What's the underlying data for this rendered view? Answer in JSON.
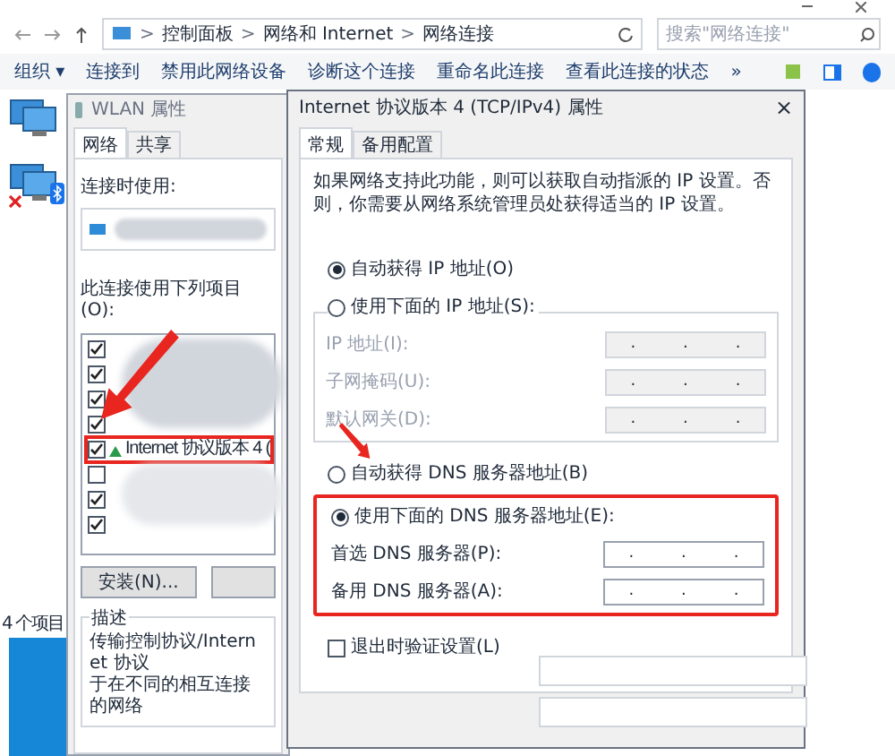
{
  "explorer": {
    "breadcrumbs": [
      "控制面板",
      "网络和 Internet",
      "网络连接"
    ],
    "separator": ">",
    "search": {
      "placeholder": "搜索\"网络连接\""
    },
    "toolbar": [
      "组织 ▾",
      "连接到",
      "禁用此网络设备",
      "诊断这个连接",
      "重命名此连接",
      "查看此连接的状态",
      "»"
    ],
    "connections": [
      {
        "kind": "ethernet",
        "disconnected": false
      },
      {
        "kind": "bluetooth",
        "disconnected": true
      }
    ],
    "status": "4 个项目"
  },
  "wlan_dialog": {
    "title": "WLAN 属性",
    "tabs": [
      {
        "label": "网络",
        "selected": true
      },
      {
        "label": "共享",
        "selected": false
      }
    ],
    "connect_using_label": "连接时使用:",
    "items_label": "此连接使用下列项目(O):",
    "items": [
      {
        "checked": true
      },
      {
        "checked": true
      },
      {
        "checked": true
      },
      {
        "checked": true
      },
      {
        "label": "Internet 协议版本 4 (",
        "checked": true,
        "highlighted": true
      },
      {
        "checked": false
      },
      {
        "checked": true
      },
      {
        "checked": true
      }
    ],
    "buttons": [
      "安装(N)..."
    ],
    "description_label": "描述",
    "description_lines": [
      "传输控制协议/Internet 协议",
      "于在不同的相互连接的网络"
    ]
  },
  "tcp_dialog": {
    "title": "Internet 协议版本 4 (TCP/IPv4) 属性",
    "close": "×",
    "tabs": [
      {
        "label": "常规",
        "selected": true
      },
      {
        "label": "备用配置",
        "selected": false
      }
    ],
    "intro": "如果网络支持此功能，则可以获取自动指派的 IP 设置。否则，你需要从网络系统管理员处获得适当的 IP 设置。",
    "ip_options": [
      {
        "label": "自动获得 IP 地址(O)",
        "selected": true
      },
      {
        "label": "使用下面的 IP 地址(S):",
        "selected": false
      }
    ],
    "ip_fields": [
      {
        "label": "IP 地址(I):",
        "value": ". . .",
        "disabled": true
      },
      {
        "label": "子网掩码(U):",
        "value": ". . .",
        "disabled": true
      },
      {
        "label": "默认网关(D):",
        "value": ". . .",
        "disabled": true
      }
    ],
    "dns_options": [
      {
        "label": "自动获得 DNS 服务器地址(B)",
        "selected": false,
        "highlighted": false
      },
      {
        "label": "使用下面的 DNS 服务器地址(E):",
        "selected": true,
        "highlighted": true
      }
    ],
    "dns_fields": [
      {
        "label": "首选 DNS 服务器(P):",
        "value": ". . .",
        "disabled": false
      },
      {
        "label": "备用 DNS 服务器(A):",
        "value": ". . .",
        "disabled": false
      }
    ],
    "validate": {
      "label": "退出时验证设置(L)",
      "checked": false
    }
  }
}
